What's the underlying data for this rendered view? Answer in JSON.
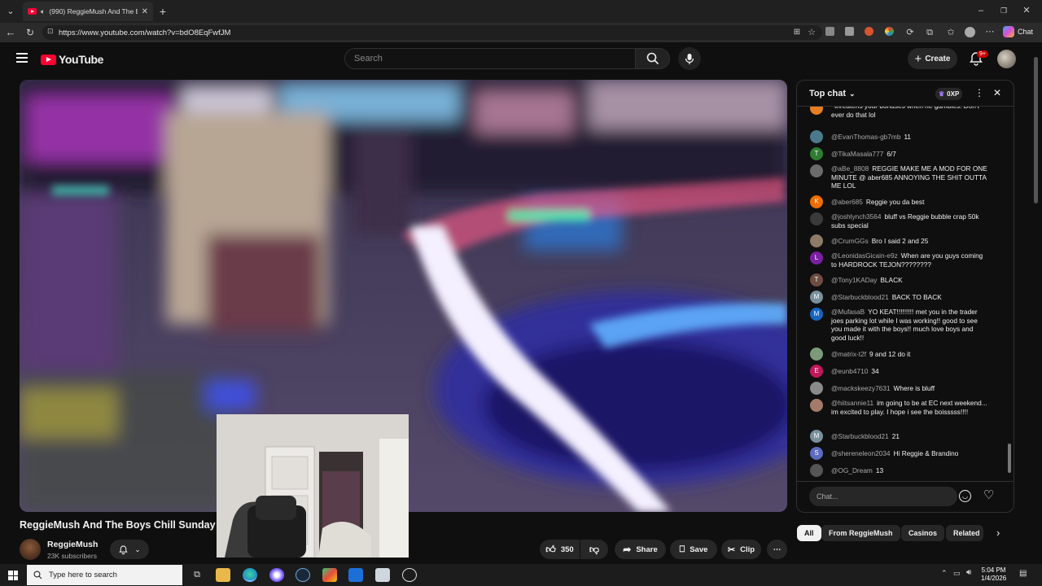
{
  "browser": {
    "tab_title": "(990) ReggieMush And The B",
    "url": "https://www.youtube.com/watch?v=bdO8EqFwfJM",
    "chat_label": "Chat"
  },
  "header": {
    "logo_text": "YouTube",
    "search_placeholder": "Search",
    "create_label": "Create",
    "notification_badge": "9+"
  },
  "video": {
    "title": "ReggieMush And The Boys Chill Sunday",
    "channel_name": "ReggieMush",
    "subscribers": "23K subscribers",
    "like_count": "350",
    "share_label": "Share",
    "save_label": "Save",
    "clip_label": "Clip"
  },
  "chat": {
    "header_label": "Top chat",
    "xp_label": "0XP",
    "input_placeholder": "Chat...",
    "messages": [
      {
        "author": "",
        "text": "threatens your bonuses when he gambles. Don't ever do that lol",
        "initial": "",
        "color": "#e67e22"
      },
      {
        "author": "@EvanThomas-gb7mb",
        "text": "11",
        "initial": "",
        "color": "#4a7a8c"
      },
      {
        "author": "@TikaMasala777",
        "text": "6/7",
        "initial": "T",
        "color": "#2e7d32"
      },
      {
        "author": "@aBe_8808",
        "text": "REGGIE MAKE ME A MOD FOR ONE MINUTE @ aber685 ANNOYING THE SHIT OUTTA ME LOL",
        "initial": "",
        "color": "#6b6b6b"
      },
      {
        "author": "@aber685",
        "text": "Reggie you da best",
        "initial": "K",
        "color": "#ef6c00"
      },
      {
        "author": "@joshlynch3564",
        "text": "bluff vs Reggie bubble crap 50k subs special",
        "initial": "",
        "color": "#3a3a3a"
      },
      {
        "author": "@CrumGGs",
        "text": "Bro I said 2 and 25",
        "initial": "",
        "color": "#8d7b68"
      },
      {
        "author": "@LeonidasGicain-e9z",
        "text": "When are you guys coming to HARDROCK TEJON????????",
        "initial": "L",
        "color": "#7b1fa2"
      },
      {
        "author": "@Tony1KADay",
        "text": "BLACK",
        "initial": "T",
        "color": "#6d4c41"
      },
      {
        "author": "@Starbuckblood21",
        "text": "BACK TO BACK",
        "initial": "M",
        "color": "#78909c"
      },
      {
        "author": "@MufasaB",
        "text": "YO KEAT!!!!!!!!! met you in the trader joes parking lot while I was working!! good to see you made it with the boys!! much love boys and good luck!!",
        "initial": "M",
        "color": "#1565c0"
      },
      {
        "author": "@matrix-t2f",
        "text": "9 and 12 do it",
        "initial": "",
        "color": "#7a9a7a"
      },
      {
        "author": "@eunb4710",
        "text": "34",
        "initial": "E",
        "color": "#c2185b"
      },
      {
        "author": "@mackskeezy7631",
        "text": "Where is bluff",
        "initial": "",
        "color": "#8a8a8a"
      },
      {
        "author": "@hiitsannie11",
        "text": "im going to be at EC next weekend... im excited to play. I hope i see the boisssss!!!!",
        "initial": "",
        "color": "#a47a6a"
      },
      {
        "author": "@Starbuckblood21",
        "text": "21",
        "initial": "M",
        "color": "#78909c"
      },
      {
        "author": "@shereneleon2034",
        "text": "Hi Reggie & Brandino",
        "initial": "S",
        "color": "#5c6bc0"
      },
      {
        "author": "@OG_Dream",
        "text": "13",
        "initial": "",
        "color": "#555555"
      }
    ]
  },
  "chips": [
    "All",
    "From ReggieMush",
    "Casinos",
    "Related"
  ],
  "taskbar": {
    "search_placeholder": "Type here to search",
    "time": "5:04 PM",
    "date": "1/4/2026"
  }
}
